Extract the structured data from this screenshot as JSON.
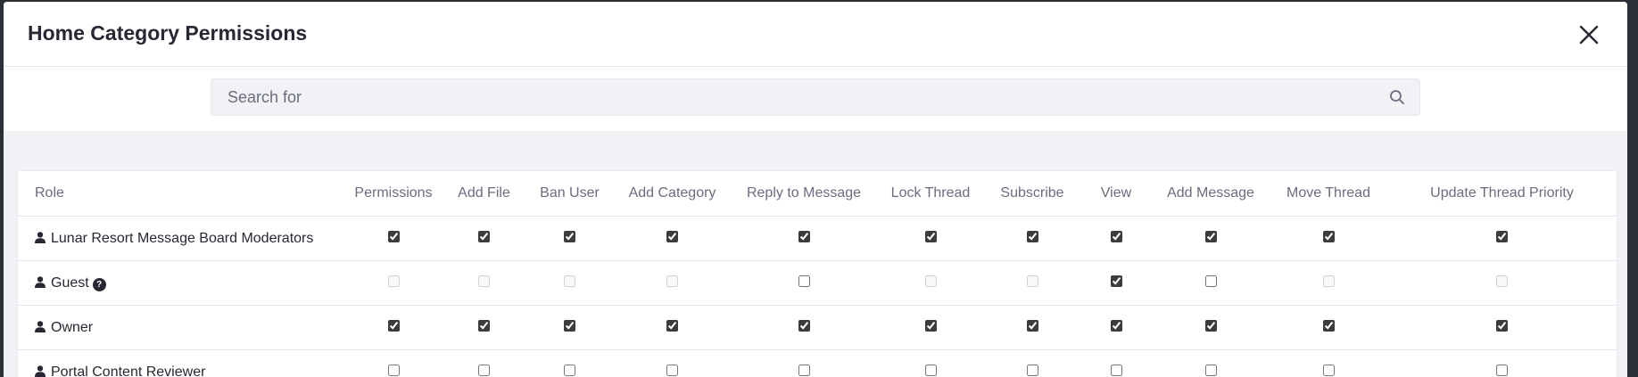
{
  "modal": {
    "title": "Home Category Permissions"
  },
  "search": {
    "placeholder": "Search for",
    "value": ""
  },
  "table": {
    "role_header": "Role",
    "columns": [
      "Permissions",
      "Add File",
      "Ban User",
      "Add Category",
      "Reply to Message",
      "Lock Thread",
      "Subscribe",
      "View",
      "Add Message",
      "Move Thread",
      "Update Thread Priority"
    ],
    "rows": [
      {
        "role": "Lunar Resort Message Board Moderators",
        "has_help": false,
        "checks": [
          true,
          true,
          true,
          true,
          true,
          true,
          true,
          true,
          true,
          true,
          true
        ],
        "disabled": [
          false,
          false,
          false,
          false,
          false,
          false,
          false,
          false,
          false,
          false,
          false
        ]
      },
      {
        "role": "Guest",
        "has_help": true,
        "help_symbol": "?",
        "checks": [
          false,
          false,
          false,
          false,
          false,
          false,
          false,
          true,
          false,
          false,
          false
        ],
        "disabled": [
          true,
          true,
          true,
          true,
          false,
          true,
          true,
          false,
          false,
          true,
          true
        ]
      },
      {
        "role": "Owner",
        "has_help": false,
        "checks": [
          true,
          true,
          true,
          true,
          true,
          true,
          true,
          true,
          true,
          true,
          true
        ],
        "disabled": [
          false,
          false,
          false,
          false,
          false,
          false,
          false,
          false,
          false,
          false,
          false
        ]
      },
      {
        "role": "Portal Content Reviewer",
        "has_help": false,
        "checks": [
          false,
          false,
          false,
          false,
          false,
          false,
          false,
          false,
          false,
          false,
          false
        ],
        "disabled": [
          false,
          false,
          false,
          false,
          false,
          false,
          false,
          false,
          false,
          false,
          false
        ]
      }
    ]
  },
  "icons": {
    "close": "close-icon",
    "search": "search-icon",
    "role": "user-icon",
    "help": "question-circle-icon"
  },
  "colors": {
    "title_text": "#272833",
    "header_text": "#6b6c7e",
    "search_bg": "#f1f2f5",
    "band_bg": "#f1f2f5",
    "border": "#e7e7ed"
  }
}
